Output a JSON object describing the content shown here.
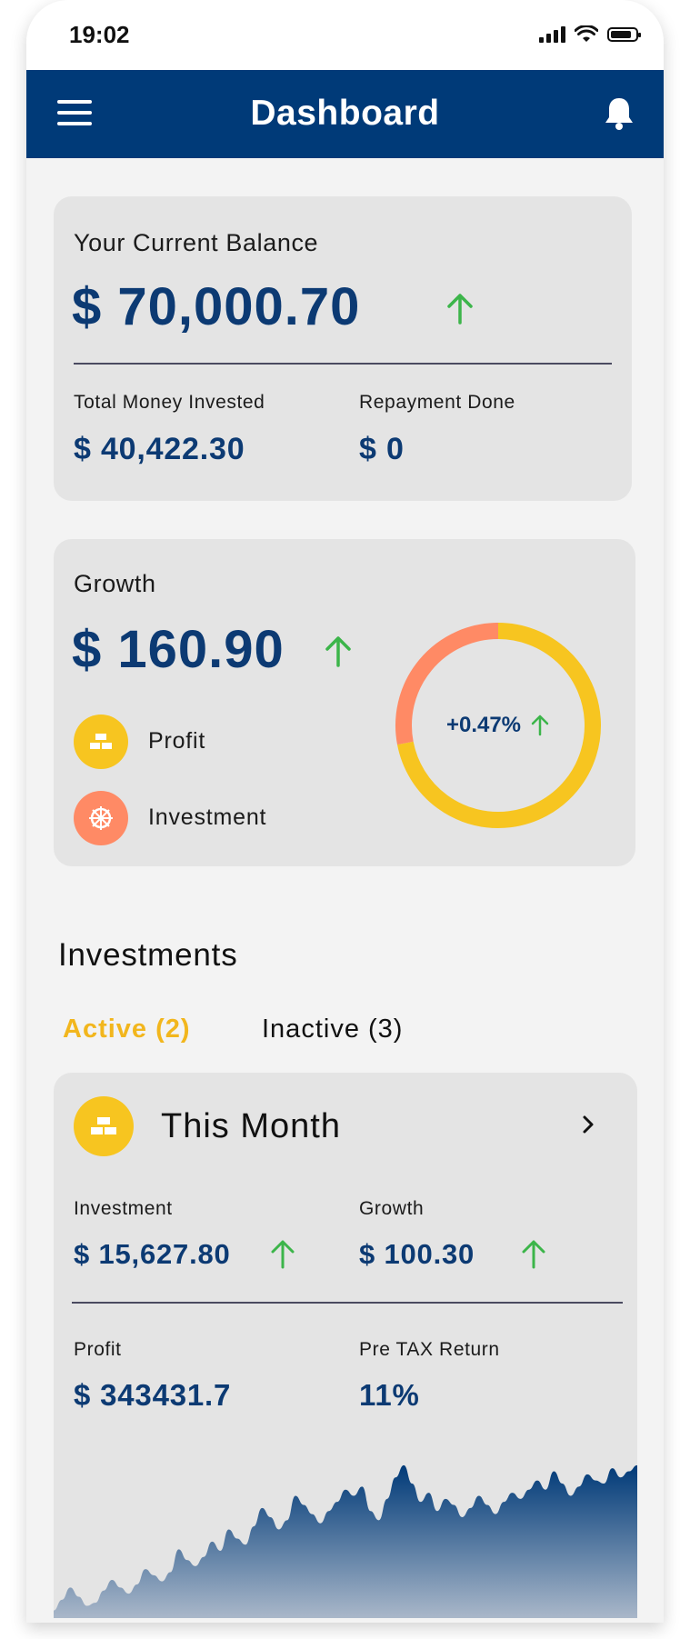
{
  "status_bar": {
    "time": "19:02"
  },
  "header": {
    "title": "Dashboard",
    "menu_icon": "hamburger-menu-icon",
    "bell_icon": "bell-icon"
  },
  "balance": {
    "label": "Your Current Balance",
    "value": "$ 70,000.70",
    "trend_icon": "arrow-up-icon",
    "total_invested_label": "Total Money Invested",
    "total_invested_value": "$ 40,422.30",
    "repayment_label": "Repayment Done",
    "repayment_value": "$ 0"
  },
  "growth": {
    "label": "Growth",
    "value": "$ 160.90",
    "legend": [
      {
        "label": "Profit",
        "icon": "gold-bars-icon",
        "color": "#f7c520"
      },
      {
        "label": "Investment",
        "icon": "wheel-icon",
        "color": "#ff8a65"
      }
    ],
    "donut_percent": "+0.47%",
    "donut_segments": [
      {
        "name": "Profit",
        "fraction": 0.72,
        "color": "#f7c520"
      },
      {
        "name": "Investment",
        "fraction": 0.28,
        "color": "#ff8a65"
      }
    ]
  },
  "investments": {
    "title": "Investments",
    "tabs": [
      {
        "label": "Active (2)",
        "active": true
      },
      {
        "label": "Inactive (3)",
        "active": false
      }
    ],
    "card": {
      "title": "This Month",
      "investment_label": "Investment",
      "investment_value": "$ 15,627.80",
      "growth_label": "Growth",
      "growth_value": "$ 100.30",
      "profit_label": "Profit",
      "profit_value": "$ 343431.7",
      "pretax_label": "Pre TAX Return",
      "pretax_value": "11%"
    }
  },
  "colors": {
    "navy": "#003a78",
    "accent_yellow": "#f2b61d",
    "up_green": "#3cb54a",
    "coral": "#ff8a65"
  },
  "chart_data": {
    "type": "area",
    "x": [
      0,
      1,
      2,
      3,
      4,
      5,
      6,
      7,
      8,
      9,
      10,
      11,
      12,
      13,
      14,
      15,
      16,
      17,
      18,
      19,
      20,
      21,
      22,
      23,
      24,
      25,
      26,
      27,
      28,
      29,
      30,
      31,
      32,
      33,
      34,
      35,
      36,
      37,
      38,
      39,
      40,
      41,
      42,
      43,
      44,
      45,
      46,
      47,
      48,
      49,
      50,
      51,
      52,
      53,
      54,
      55,
      56,
      57,
      58,
      59,
      60,
      61,
      62,
      63,
      64,
      65,
      66,
      67,
      68,
      69,
      70
    ],
    "values": [
      5,
      12,
      20,
      14,
      8,
      10,
      18,
      25,
      20,
      16,
      22,
      32,
      28,
      24,
      30,
      45,
      38,
      34,
      40,
      50,
      44,
      58,
      52,
      48,
      60,
      72,
      66,
      58,
      64,
      80,
      74,
      68,
      62,
      70,
      76,
      84,
      80,
      86,
      70,
      64,
      78,
      92,
      100,
      88,
      76,
      82,
      70,
      78,
      74,
      66,
      72,
      80,
      74,
      68,
      76,
      82,
      78,
      84,
      90,
      84,
      96,
      88,
      80,
      86,
      94,
      90,
      88,
      98,
      92,
      96,
      100
    ],
    "ylim": [
      0,
      110
    ]
  }
}
